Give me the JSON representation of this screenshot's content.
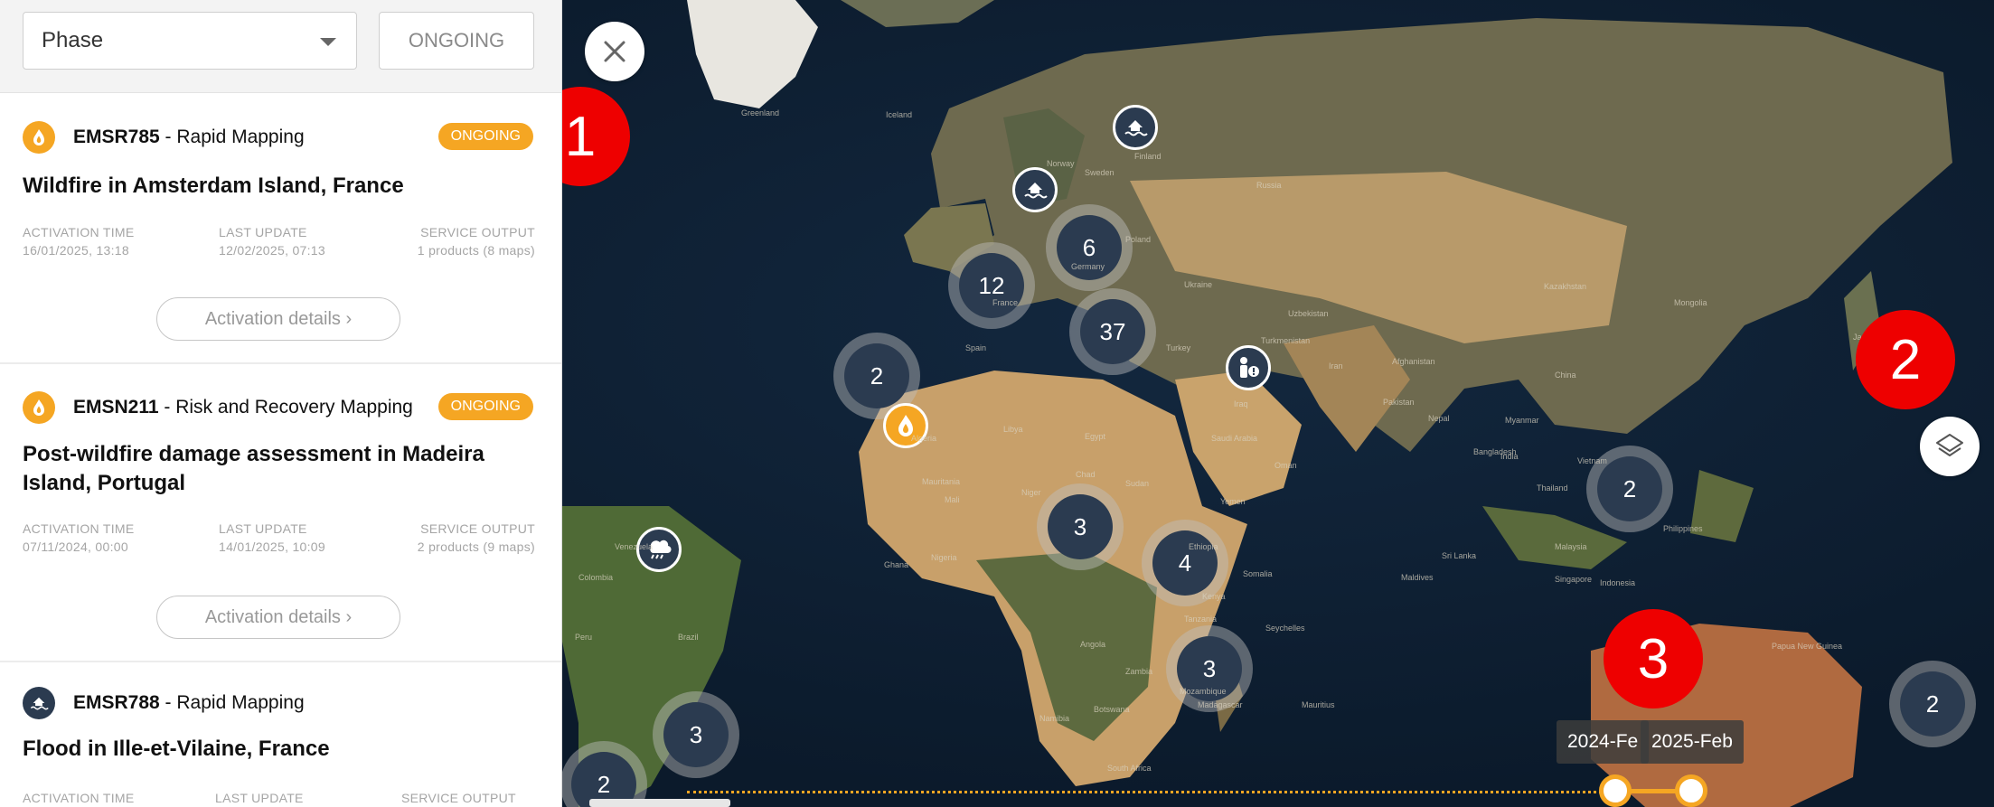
{
  "filters": {
    "phase_label": "Phase",
    "ongoing_label": "ONGOING"
  },
  "activations": [
    {
      "code": "EMSR785",
      "service": " - Rapid Mapping",
      "type_icon": "wildfire-icon",
      "status": "ONGOING",
      "title": "Wildfire in Amsterdam Island, France",
      "activation_time_label": "ACTIVATION TIME",
      "activation_time": "16/01/2025, 13:18",
      "last_update_label": "LAST UPDATE",
      "last_update": "12/02/2025, 07:13",
      "service_output_label": "SERVICE OUTPUT",
      "service_output": "1 products (8 maps)",
      "details_label": "Activation details"
    },
    {
      "code": "EMSN211",
      "service": " - Risk and Recovery Mapping",
      "type_icon": "wildfire-icon",
      "status": "ONGOING",
      "title": "Post-wildfire damage assessment in Madeira Island, Portugal",
      "activation_time_label": "ACTIVATION TIME",
      "activation_time": "07/11/2024, 00:00",
      "last_update_label": "LAST UPDATE",
      "last_update": "14/01/2025, 10:09",
      "service_output_label": "SERVICE OUTPUT",
      "service_output": "2 products (9 maps)",
      "details_label": "Activation details"
    },
    {
      "code": "EMSR788",
      "service": " - Rapid Mapping",
      "type_icon": "flood-icon",
      "title": "Flood in Ille-et-Vilaine, France",
      "activation_time_label": "ACTIVATION TIME",
      "last_update_label": "LAST UPDATE",
      "service_output_label": "SERVICE OUTPUT"
    }
  ],
  "clusters": [
    "6",
    "12",
    "37",
    "2",
    "3",
    "4",
    "3",
    "3",
    "2",
    "2",
    "2"
  ],
  "annotations": [
    "1",
    "2",
    "3"
  ],
  "timeline": {
    "start_label": "2024-Fe",
    "end_label": "2025-Feb"
  },
  "map_labels": [
    "Kazakhstan",
    "Mongolia",
    "Egypt",
    "Libya",
    "Algeria",
    "Mauritania",
    "Niger",
    "Chad",
    "Sudan",
    "Ethiopia",
    "Kenya",
    "Somalia",
    "Iran",
    "Iraq",
    "Afghanistan",
    "Pakistan",
    "India",
    "China",
    "Japan",
    "Philippines",
    "Indonesia",
    "Brazil",
    "Colombia",
    "Venezuela",
    "Peru",
    "Madagascar",
    "Namibia",
    "Botswana",
    "Turkey",
    "Ukraine",
    "Spain",
    "France",
    "Germany",
    "Poland",
    "Norway",
    "Sweden",
    "Finland",
    "Russia",
    "Saudi Arabia",
    "Yemen",
    "Oman",
    "Thailand",
    "Vietnam",
    "Malaysia",
    "Papua New Guinea",
    "Nigeria",
    "Ghana",
    "Mali",
    "Angola",
    "Zambia",
    "Tanzania",
    "Mozambique",
    "South Africa",
    "Uzbekistan",
    "Turkmenistan",
    "Myanmar",
    "Bangladesh",
    "Nepal",
    "Sri Lanka",
    "Maldives",
    "Seychelles",
    "Mauritius",
    "Singapore",
    "Greenland",
    "Iceland"
  ]
}
